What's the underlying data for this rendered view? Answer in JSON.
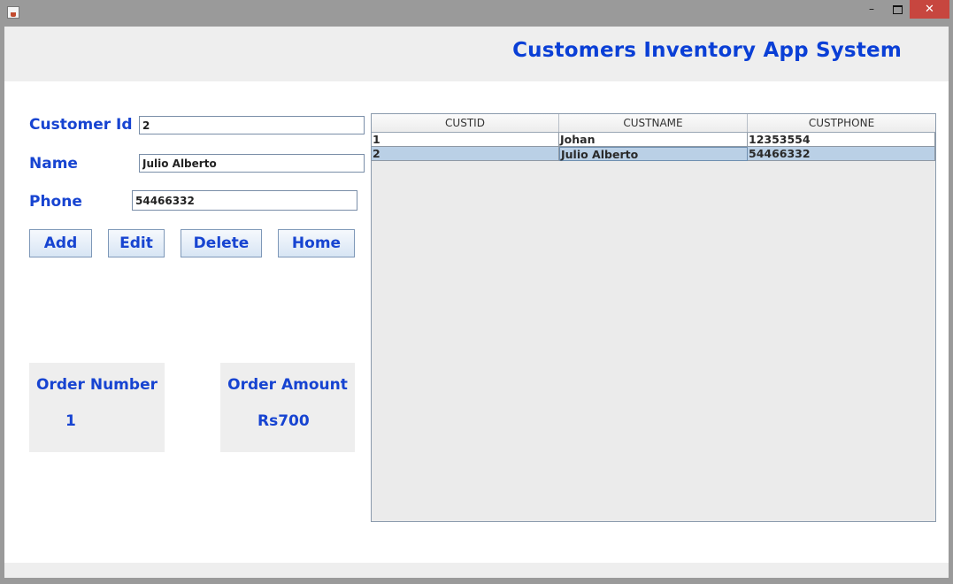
{
  "window": {
    "controls": {
      "minimize": "–",
      "close": "✕"
    }
  },
  "app": {
    "title": "Customers Inventory App System"
  },
  "form": {
    "customer_id": {
      "label": "Customer Id",
      "value": "2"
    },
    "name": {
      "label": "Name",
      "value": "Julio Alberto"
    },
    "phone": {
      "label": "Phone",
      "value": "54466332"
    }
  },
  "buttons": {
    "add": "Add",
    "edit": "Edit",
    "delete": "Delete",
    "home": "Home"
  },
  "stats": {
    "order_number": {
      "title": "Order Number",
      "value": "1"
    },
    "order_amount": {
      "title": "Order Amount",
      "value": "Rs700"
    }
  },
  "table": {
    "columns": [
      "CUSTID",
      "CUSTNAME",
      "CUSTPHONE"
    ],
    "rows": [
      {
        "cells": [
          "1",
          "Johan",
          "12353554"
        ],
        "selected": false
      },
      {
        "cells": [
          "2",
          "Julio Alberto",
          "54466332"
        ],
        "selected": true
      }
    ]
  },
  "colors": {
    "accent": "#1744d1",
    "title": "#0a3fd6",
    "selected_row": "#bad0e6",
    "close_button": "#c7463f"
  }
}
